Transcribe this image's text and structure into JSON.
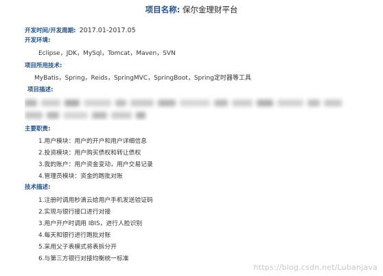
{
  "project": {
    "title_label": "项目名称:",
    "title_value": "保尔金理财平台"
  },
  "period": {
    "label": "开发时间/开发周期:",
    "value": "2017.01-2017.05"
  },
  "environment": {
    "label": "开发环境:",
    "value": "Eclipse，JDK，MySql，Tomcat，Maven，SVN"
  },
  "tech_stack": {
    "label": "项目所用技术:",
    "value": "MyBatis，Spring，Reids，SpringMVC，SpringBoot，Spring定时器等工具"
  },
  "description": {
    "label": "项目描述:"
  },
  "responsibilities": {
    "label": "主要职责:",
    "items": [
      "1.用户模块：用户的开户和用户详细信息",
      "2.投资模块：用户购买债权和转让债权",
      "3.我的账户：用户资金变动，用户交易记录",
      "4.管理员模块：资金的跑批对账"
    ]
  },
  "technical": {
    "label": "技术描述:",
    "items": [
      "1.注册时调用秒滴云给用户手机发送验证码",
      "2.实现与银行接口进行对接",
      "3.用户开户时调用 IBIS，进行人脸识别",
      "4.每天和银行进行跑批对账",
      "5.采用父子表模式将表拆分开",
      "6.与第三方银行对接均衡统一标准"
    ]
  },
  "watermark": "https://blog.csdn.net/Lubanjava"
}
